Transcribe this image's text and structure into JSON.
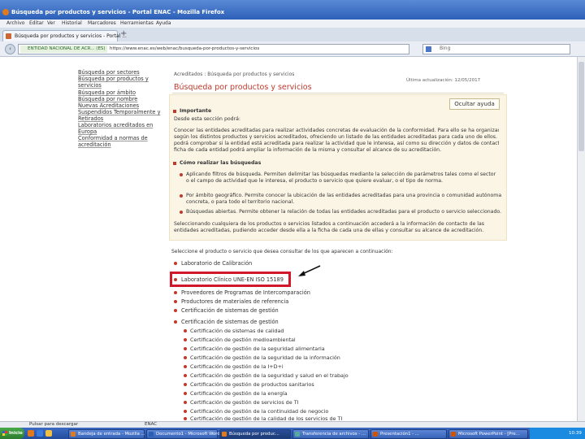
{
  "window": {
    "title": "Búsqueda por productos y servicios - Portal ENAC - Mozilla Firefox"
  },
  "menubar": [
    "Archivo",
    "Editar",
    "Ver",
    "Historial",
    "Marcadores",
    "Herramientas",
    "Ayuda"
  ],
  "tabs": [
    {
      "label": "Búsqueda por productos y servicios - Portal ..."
    }
  ],
  "navbar": {
    "site_identity": "ENTIDAD NACIONAL DE ACR... (ES)",
    "url": "https://www.enac.es/web/enac/busqueda-por-productos-y-servicios",
    "search_placeholder": "Bing"
  },
  "sidebar": {
    "items": [
      "Búsqueda por sectores",
      "Búsqueda por productos y",
      "servicios",
      "Búsqueda por ámbito",
      "Búsqueda por nombre",
      "Nuevas Acreditaciones",
      "Suspendidos Temporalmente y",
      "Retirados",
      "Laboratorios acreditados en",
      "Europa",
      "Conformidad a normas de",
      "acreditación"
    ]
  },
  "main": {
    "breadcrumb": "Acreditados : Búsqueda por productos y servicios",
    "date": "Última actualización: 12/05/2017",
    "heading": "Búsqueda por productos y servicios",
    "help_button": "Ocultar ayuda",
    "info": {
      "important_title": "Importante",
      "important_sub": "Desde esta sección podrá:",
      "paragraph": [
        "Conocer las entidades acreditadas para realizar actividades concretas de evaluación de la conformidad. Para ello se ha organizado la información",
        "según los distintos productos y servicios acreditados, ofreciendo un listado de las entidades acreditadas para cada uno de ellos. Con esta información",
        "podrá comprobar si la entidad está acreditada para realizar la actividad que le interesa, así como su dirección y datos de contacto. Accediendo a la",
        "ficha de cada entidad podrá ampliar la información de la misma y consultar el alcance de su acreditación."
      ],
      "how_title": "Cómo realizar las búsquedas",
      "bullets": [
        [
          "Aplicando filtros de búsqueda. Permiten delimitar las búsquedas mediante la selección de parámetros tales como el sector",
          "o el campo de actividad que le interesa, el producto o servicio que quiere evaluar, o el tipo de norma."
        ],
        [
          "Por ámbito geográfico. Permite conocer la ubicación de las entidades acreditadas para una provincia o comunidad autónoma",
          "concreta, o para todo el territorio nacional."
        ],
        [
          "Búsquedas abiertas. Permite obtener la relación de todas las entidades acreditadas para el producto o servicio seleccionado."
        ]
      ],
      "footer": [
        "Seleccionando cualquiera de los productos o servicios listados a continuación accederá a la información de contacto de las",
        "entidades acreditadas, pudiendo acceder desde ella a la ficha de cada una de ellas y consultar su alcance de acreditación."
      ]
    },
    "lower_intro": "Seleccione el producto o servicio que desea consultar de los que aparecen a continuación:",
    "list": [
      "Laboratorio de Calibración",
      "Laboratorio Clínico UNE-EN ISO 15189",
      "Proveedores de Programas de Intercomparación",
      "Productores de materiales de referencia",
      "Certificación de sistemas de gestión",
      "Certificación de sistemas de gestión"
    ],
    "sublist": [
      "Certificación de sistemas de calidad",
      "Certificación de gestión medioambiental",
      "Certificación de gestión de la seguridad alimentaria",
      "Certificación de gestión de la seguridad de la información",
      "Certificación de gestión de la I+D+i",
      "Certificación de gestión de la seguridad y salud en el trabajo",
      "Certificación de gestión de productos sanitarios",
      "Certificación de gestión de la energía",
      "Certificación de gestión de servicios de TI",
      "Certificación de gestión de la continuidad de negocio",
      "Certificación de gestión de la calidad de los servicios de TI"
    ]
  },
  "statusbar": {
    "left": "Pulsar para descargar",
    "middle": "ENAC"
  },
  "taskbar": {
    "start": "Inicio",
    "tasks": [
      "Bandeja de entrada - Mozilla ...",
      "Documento1 - Microsoft Word",
      "Búsqueda por produc...",
      "Transferencia de archivos - ...",
      "Presentación1 - ...",
      "Microsoft PowerPoint - [Pre..."
    ],
    "clock": "10:39"
  },
  "colors": {
    "accent": "#c0392b",
    "highlight": "#d1182b",
    "infobox": "#fbf5e6"
  }
}
